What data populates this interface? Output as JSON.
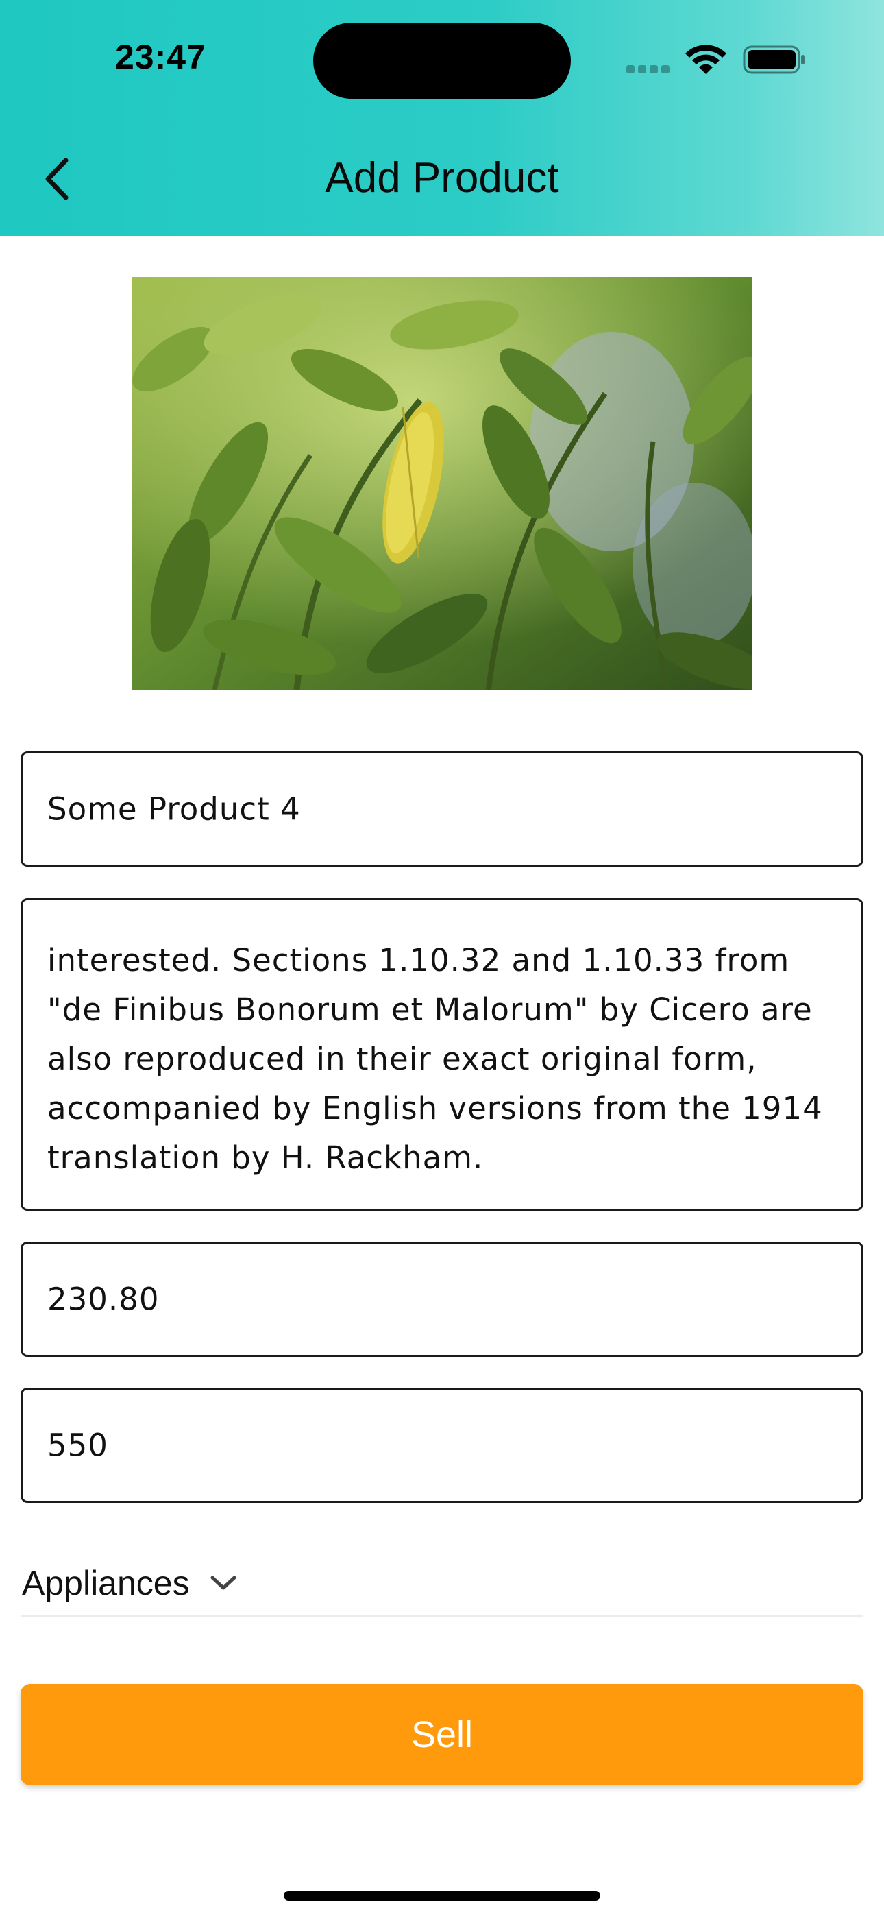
{
  "status_bar": {
    "time": "23:47"
  },
  "header": {
    "title": "Add Product",
    "back_icon": "chevron-left-icon",
    "gradient_colors": [
      "#1fc8c2",
      "#8fe4de"
    ]
  },
  "product": {
    "image_subject": "green leaves with yellow leaf",
    "name": "Some Product 4",
    "description": "interested. Sections 1.10.32 and 1.10.33 from\n\"de Finibus Bonorum et Malorum\" by Cicero are\nalso reproduced in their exact original form,\naccompanied by English versions from the 1914\ntranslation by H. Rackham.",
    "price": "230.80",
    "quantity": "550",
    "category": "Appliances"
  },
  "actions": {
    "sell_label": "Sell",
    "sell_color": "#ff9a0c"
  }
}
